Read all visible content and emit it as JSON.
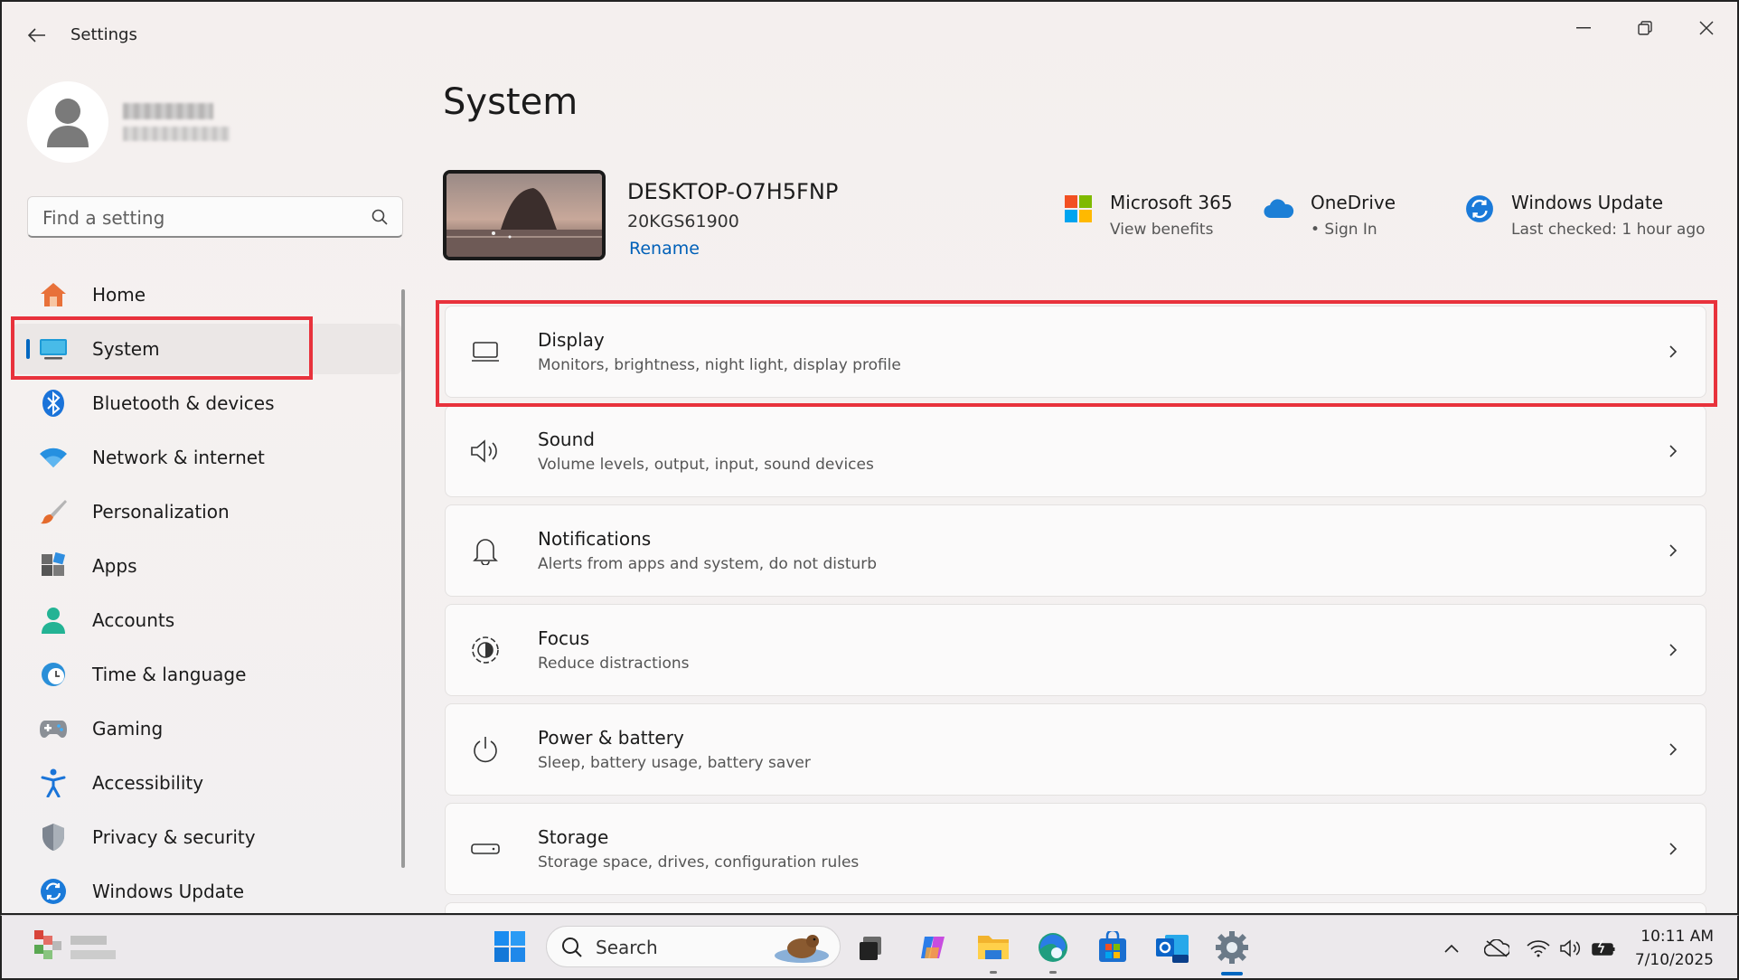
{
  "window": {
    "title": "Settings",
    "controls": [
      "minimize-button",
      "restore-button",
      "close-button"
    ]
  },
  "sidebar": {
    "search_placeholder": "Find a setting",
    "items": [
      {
        "label": "Home",
        "icon": "home-icon"
      },
      {
        "label": "System",
        "icon": "system-monitor-icon",
        "active": true
      },
      {
        "label": "Bluetooth & devices",
        "icon": "bluetooth-icon"
      },
      {
        "label": "Network & internet",
        "icon": "wifi-icon"
      },
      {
        "label": "Personalization",
        "icon": "brush-icon"
      },
      {
        "label": "Apps",
        "icon": "apps-icon"
      },
      {
        "label": "Accounts",
        "icon": "accounts-icon"
      },
      {
        "label": "Time & language",
        "icon": "clock-globe-icon"
      },
      {
        "label": "Gaming",
        "icon": "gamepad-icon"
      },
      {
        "label": "Accessibility",
        "icon": "accessibility-icon"
      },
      {
        "label": "Privacy & security",
        "icon": "shield-icon"
      },
      {
        "label": "Windows Update",
        "icon": "update-icon"
      }
    ]
  },
  "main": {
    "title": "System",
    "device": {
      "name": "DESKTOP-O7H5FNP",
      "model": "20KGS61900",
      "rename_label": "Rename"
    },
    "tiles": [
      {
        "title": "Microsoft 365",
        "subtitle": "View benefits",
        "icon": "microsoft-365-icon"
      },
      {
        "title": "OneDrive",
        "subtitle": "• Sign In",
        "icon": "onedrive-cloud-icon"
      },
      {
        "title": "Windows Update",
        "subtitle": "Last checked: 1 hour ago",
        "icon": "windows-update-icon"
      }
    ],
    "cards": [
      {
        "title": "Display",
        "subtitle": "Monitors, brightness, night light, display profile",
        "icon": "display-icon"
      },
      {
        "title": "Sound",
        "subtitle": "Volume levels, output, input, sound devices",
        "icon": "speaker-icon"
      },
      {
        "title": "Notifications",
        "subtitle": "Alerts from apps and system, do not disturb",
        "icon": "bell-icon"
      },
      {
        "title": "Focus",
        "subtitle": "Reduce distractions",
        "icon": "focus-icon"
      },
      {
        "title": "Power & battery",
        "subtitle": "Sleep, battery usage, battery saver",
        "icon": "power-icon"
      },
      {
        "title": "Storage",
        "subtitle": "Storage space, drives, configuration rules",
        "icon": "storage-drive-icon"
      }
    ]
  },
  "taskbar": {
    "search_label": "Search",
    "apps": [
      "task-view-icon",
      "copilot-icon",
      "file-explorer-icon",
      "edge-icon",
      "microsoft-store-icon",
      "outlook-new-icon",
      "settings-gear-icon"
    ],
    "tray": [
      "chevron-up-icon",
      "onedrive-offline-icon",
      "wifi-icon",
      "volume-icon",
      "battery-charging-icon"
    ],
    "time": "10:11 AM",
    "date": "7/10/2025"
  },
  "colors": {
    "accent": "#0067c0",
    "highlight": "#e8323c"
  }
}
